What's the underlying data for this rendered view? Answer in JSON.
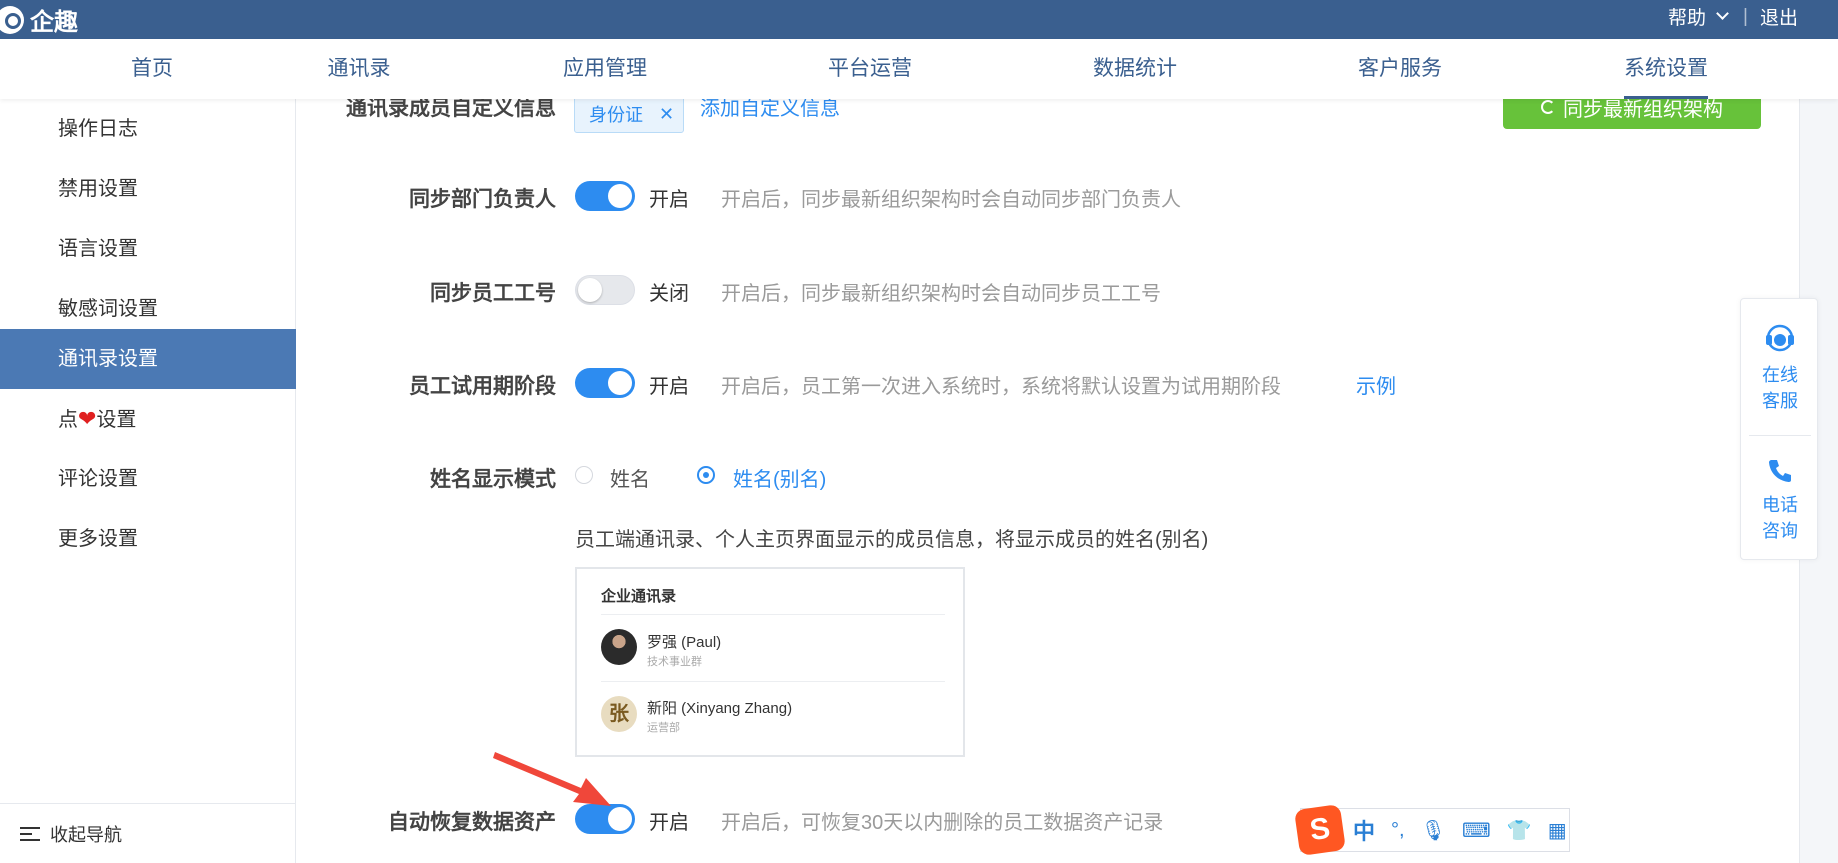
{
  "header": {
    "brand": "企趣",
    "help": "帮助",
    "logout": "退出"
  },
  "nav": [
    "首页",
    "通讯录",
    "应用管理",
    "平台运营",
    "数据统计",
    "客户服务",
    "系统设置"
  ],
  "sidebar": {
    "items": [
      "操作日志",
      "禁用设置",
      "语言设置",
      "敏感词设置",
      "通讯录设置",
      "点",
      "评论设置",
      "更多设置"
    ],
    "heart_suffix": "设置",
    "active": "通讯录设置",
    "collapse": "收起导航"
  },
  "main": {
    "custom_info": {
      "label": "通讯录成员自定义信息",
      "tag": "身份证",
      "add_link": "添加自定义信息",
      "sync_button": "同步最新组织架构"
    },
    "rows": [
      {
        "label": "同步部门负责人",
        "state": "开启",
        "desc": "开启后，同步最新组织架构时会自动同步部门负责人"
      },
      {
        "label": "同步员工工号",
        "state": "关闭",
        "desc": "开启后，同步最新组织架构时会自动同步员工工号"
      },
      {
        "label": "员工试用期阶段",
        "state": "开启",
        "desc": "开启后，员工第一次进入系统时，系统将默认设置为试用期阶段",
        "link": "示例"
      }
    ],
    "name_mode": {
      "label": "姓名显示模式",
      "options": [
        "姓名",
        "姓名(别名)"
      ],
      "selected": "姓名(别名)",
      "note": "员工端通讯录、个人主页界面显示的成员信息，将显示成员的姓名(别名)"
    },
    "preview": {
      "title": "企业通讯录",
      "members": [
        {
          "name": "罗强 (Paul)",
          "dept": "技术事业群"
        },
        {
          "name": "新阳 (Xinyang Zhang)",
          "dept": "运营部",
          "avatar_char": "张"
        }
      ]
    },
    "auto_restore": {
      "label": "自动恢复数据资产",
      "state": "开启",
      "desc": "开启后，可恢复30天以内删除的员工数据资产记录"
    }
  },
  "float_panel": {
    "online": [
      "在线",
      "客服"
    ],
    "phone": [
      "电话",
      "咨询"
    ]
  },
  "ime": {
    "logo": "S",
    "lang": "中"
  },
  "colors": {
    "header_bg": "#3a5f8f",
    "active_side": "#4b79b4",
    "accent": "#2d8cf0",
    "green": "#67c23a"
  }
}
